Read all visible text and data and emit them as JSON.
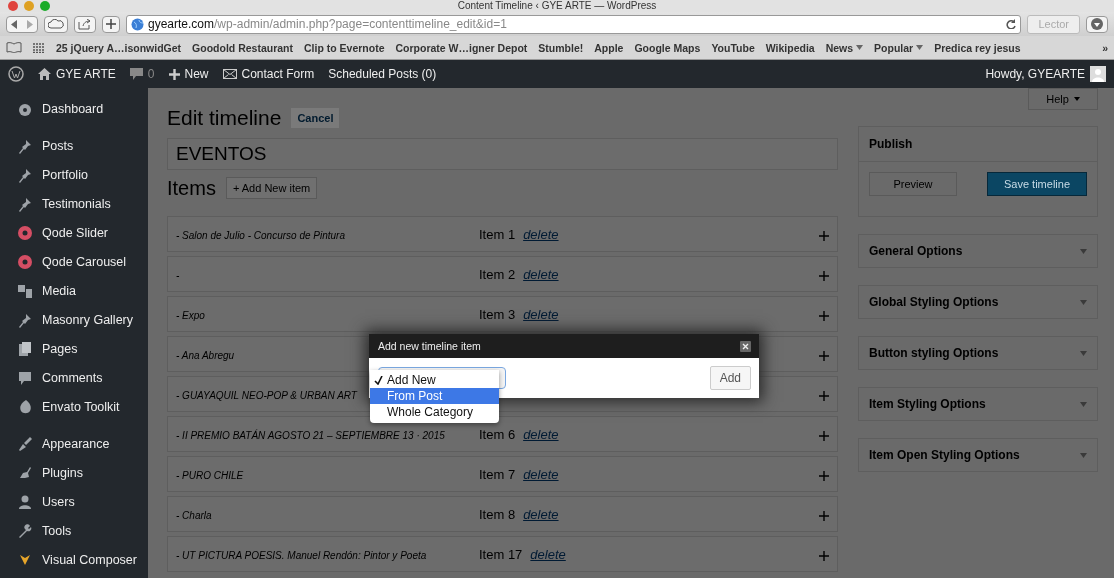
{
  "browser": {
    "title": "Content Timeline ‹ GYE ARTE — WordPress",
    "url_host": "gyearte.com",
    "url_path": "/wp-admin/admin.php?page=contenttimeline_edit&id=1",
    "reader": "Lector",
    "bookmarks": [
      {
        "label": "25 jQuery A…isonwidGet",
        "menu": false
      },
      {
        "label": "Goodold Restaurant",
        "menu": false
      },
      {
        "label": "Clip to Evernote",
        "menu": false
      },
      {
        "label": "Corporate W…igner Depot",
        "menu": false
      },
      {
        "label": "Stumble!",
        "menu": false
      },
      {
        "label": "Apple",
        "menu": false
      },
      {
        "label": "Google Maps",
        "menu": false
      },
      {
        "label": "YouTube",
        "menu": false
      },
      {
        "label": "Wikipedia",
        "menu": false
      },
      {
        "label": "News",
        "menu": true
      },
      {
        "label": "Popular",
        "menu": true
      },
      {
        "label": "Predica rey jesus",
        "menu": false
      }
    ],
    "more": "»"
  },
  "admin_bar": {
    "site": "GYE ARTE",
    "comments": "0",
    "new": "New",
    "contact": "Contact Form",
    "scheduled": "Scheduled Posts (0)",
    "howdy": "Howdy, GYEARTE"
  },
  "sidebar": {
    "groups": [
      [
        "Dashboard"
      ],
      [
        "Posts",
        "Portfolio",
        "Testimonials",
        "Qode Slider",
        "Qode Carousel",
        "Media",
        "Masonry Gallery",
        "Pages",
        "Comments",
        "Envato Toolkit"
      ],
      [
        "Appearance",
        "Plugins",
        "Users",
        "Tools",
        "Visual Composer"
      ]
    ]
  },
  "main": {
    "heading": "Edit timeline",
    "cancel": "Cancel",
    "name": "EVENTOS",
    "items_heading": "Items",
    "add_item": "+ Add New item",
    "items": [
      {
        "title": "- Salon de Julio - Concurso de Pintura",
        "label": "Item 1",
        "delete": "delete"
      },
      {
        "title": "-",
        "label": "Item 2",
        "delete": "delete"
      },
      {
        "title": "- Expo",
        "label": "Item 3",
        "delete": "delete"
      },
      {
        "title": "- Ana Abregu"
      },
      {
        "title": "- GUAYAQUIL NEO-POP & URBAN ART"
      },
      {
        "title": "- II PREMIO BATÁN AGOSTO 21 – SEPTIEMBRE 13 · 2015",
        "label": "Item 6",
        "delete": "delete"
      },
      {
        "title": "- PURO CHILE",
        "label": "Item 7",
        "delete": "delete"
      },
      {
        "title": "- Charla",
        "label": "Item 8",
        "delete": "delete"
      },
      {
        "title": "- UT PICTURA POESIS. Manuel Rendón: Pintor y Poeta",
        "label": "Item 17",
        "delete": "delete"
      }
    ]
  },
  "side": {
    "help": "Help",
    "publish": "Publish",
    "preview": "Preview",
    "save": "Save timeline",
    "panels": [
      "General Options",
      "Global Styling Options",
      "Button styling Options",
      "Item Styling Options",
      "Item Open Styling Options"
    ]
  },
  "dialog": {
    "title": "Add new timeline item",
    "add": "Add",
    "options": [
      {
        "label": "Add New",
        "checked": true,
        "selected": false
      },
      {
        "label": "From Post",
        "checked": false,
        "selected": true
      },
      {
        "label": "Whole Category",
        "checked": false,
        "selected": false
      }
    ]
  }
}
